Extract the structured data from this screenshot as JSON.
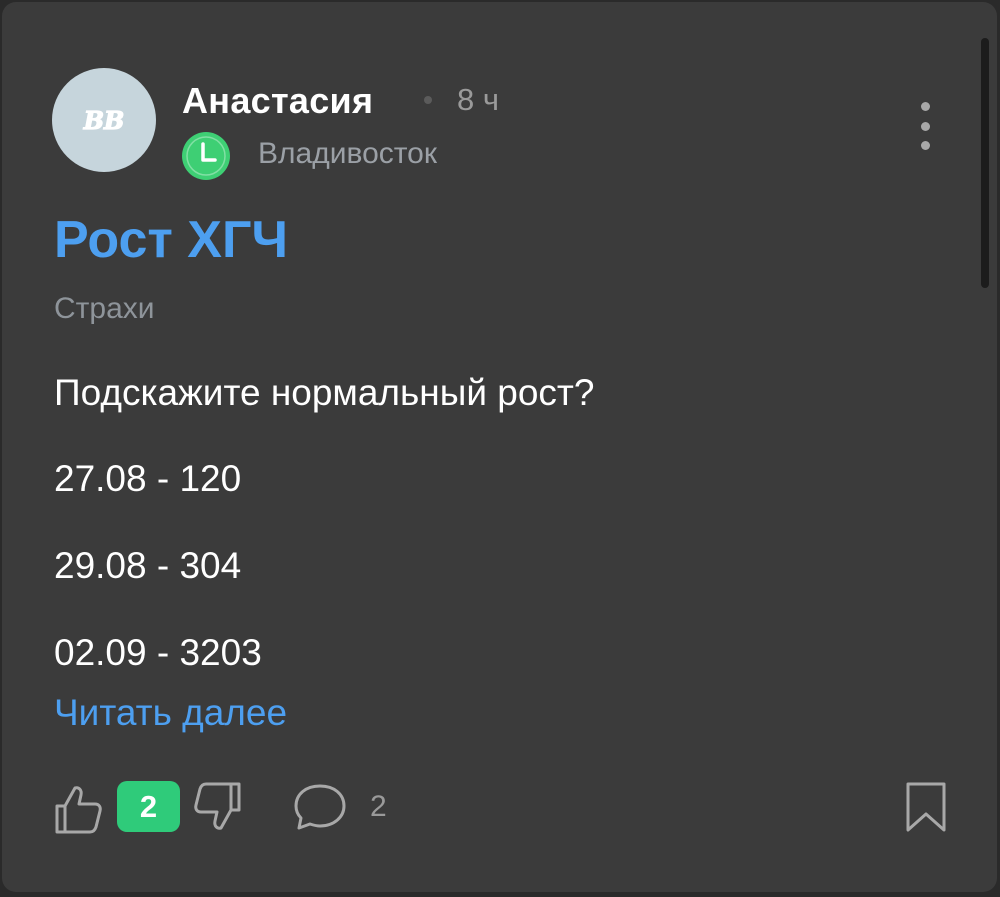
{
  "post": {
    "author": {
      "name": "Анастасия",
      "avatar_text": "ВВ",
      "time_ago": "8 ч",
      "city": "Владивосток",
      "badge_icon": "clock-icon"
    },
    "title": "Рост ХГЧ",
    "category": "Страхи",
    "body": {
      "question": "Подскажите нормальный рост?",
      "lines": [
        "27.08 - 120",
        "29.08 - 304",
        "02.09 - 3203"
      ]
    },
    "read_more": "Читать далее",
    "actions": {
      "like_icon": "thumbs-up-icon",
      "score": "2",
      "dislike_icon": "thumbs-down-icon",
      "comment_icon": "comment-bubble-icon",
      "comments_count": "2",
      "bookmark_icon": "bookmark-icon"
    }
  },
  "colors": {
    "card_background": "#3b3b3b",
    "accent_blue": "#4d9ff0",
    "score_green": "#2fcb7a",
    "clock_green": "#3ecf74",
    "muted_text": "#9a9a9a",
    "avatar_background": "#c6d5dc"
  }
}
